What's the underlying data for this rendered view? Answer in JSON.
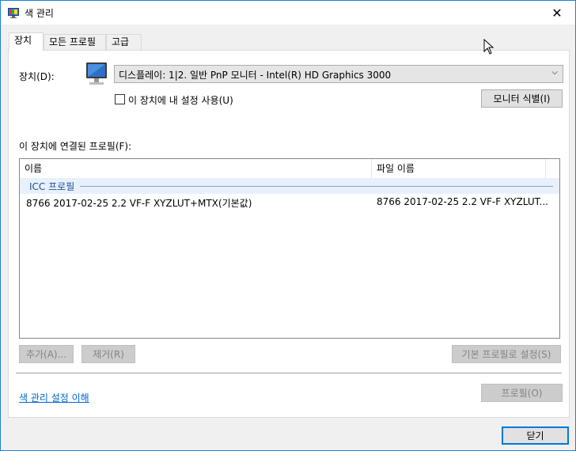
{
  "window": {
    "title": "색 관리",
    "close_glyph": "✕"
  },
  "tabs": [
    {
      "label": "장치",
      "active": true
    },
    {
      "label": "모든 프로필",
      "active": false
    },
    {
      "label": "고급",
      "active": false
    }
  ],
  "device": {
    "label": "장치(D):",
    "selected": "디스플레이: 1|2. 일반 PnP 모니터 - Intel(R) HD Graphics 3000",
    "checkbox_label": "이 장치에 내 설정 사용(U)",
    "checkbox_checked": false,
    "identify_button": "모니터 식별(I)",
    "icon": "monitor-icon"
  },
  "profiles": {
    "label": "이 장치에 연결된 프로필(F):",
    "columns": [
      "이름",
      "파일 이름"
    ],
    "group": "ICC 프로필",
    "rows": [
      {
        "name": "8766 2017-02-25 2.2 VF-F XYZLUT+MTX(기본값)",
        "file": "8766 2017-02-25 2.2 VF-F XYZLUT..."
      }
    ]
  },
  "buttons": {
    "add": "추가(A)...",
    "remove": "제거(R)",
    "set_default": "기본 프로필로 설정(S)",
    "profile": "프로필(O)",
    "close": "닫기"
  },
  "link": {
    "understand": "색 관리 설정 이해"
  },
  "colors": {
    "accent": "#0078d7",
    "link": "#0066cc",
    "group_bg": "#e8f1fb"
  }
}
